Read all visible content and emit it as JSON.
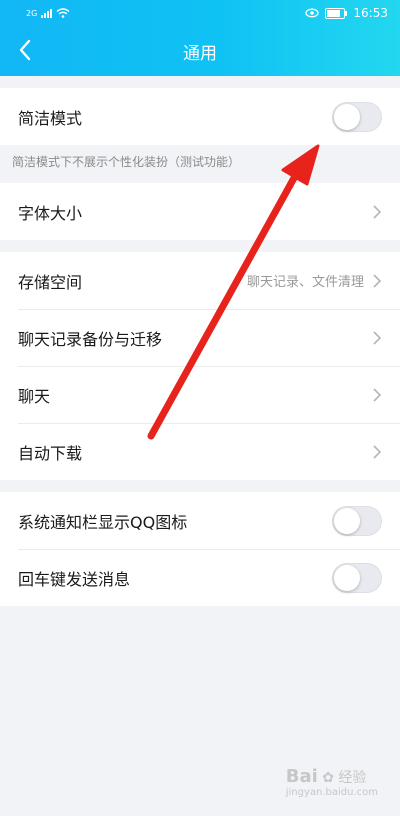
{
  "status_bar": {
    "time": "16:53",
    "network_tag": "2G"
  },
  "header": {
    "title": "通用",
    "back_icon": "chevron-left-icon"
  },
  "simple_mode": {
    "label": "简洁模式",
    "enabled": false,
    "note": "简洁模式下不展示个性化装扮（测试功能）"
  },
  "font_size": {
    "label": "字体大小"
  },
  "storage": {
    "label": "存储空间",
    "hint": "聊天记录、文件清理"
  },
  "chat_backup": {
    "label": "聊天记录备份与迁移"
  },
  "chat": {
    "label": "聊天"
  },
  "auto_download": {
    "label": "自动下载"
  },
  "notification_icon": {
    "label": "系统通知栏显示QQ图标",
    "enabled": false
  },
  "enter_send": {
    "label": "回车键发送消息",
    "enabled": false
  },
  "annotation": {
    "color": "#e8231c",
    "type": "red-arrow"
  },
  "watermark": {
    "brand": "Bai",
    "sub": "经验",
    "url": "jingyan.baidu.com"
  },
  "colors": {
    "header_start": "#12b7f5",
    "header_end": "#23d7f0",
    "background": "#f2f3f7"
  }
}
